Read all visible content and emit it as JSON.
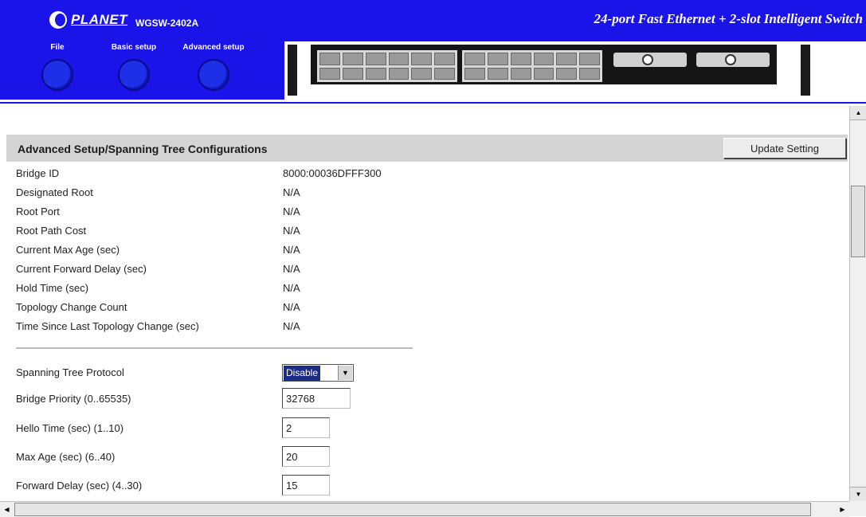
{
  "header": {
    "brand": "PLANET",
    "model": "WGSW-2402A",
    "product_title": "24-port Fast Ethernet + 2-slot Intelligent Switch",
    "menu": [
      {
        "label": "File"
      },
      {
        "label": "Basic setup"
      },
      {
        "label": "Advanced setup"
      }
    ]
  },
  "page": {
    "title": "Advanced Setup/Spanning Tree Configurations",
    "update_button": "Update Setting"
  },
  "status": [
    {
      "label": "Bridge ID",
      "value": "8000:00036DFFF300"
    },
    {
      "label": "Designated Root",
      "value": "N/A"
    },
    {
      "label": "Root Port",
      "value": "N/A"
    },
    {
      "label": "Root Path Cost",
      "value": "N/A"
    },
    {
      "label": "Current Max Age (sec)",
      "value": "N/A"
    },
    {
      "label": "Current Forward Delay (sec)",
      "value": "N/A"
    },
    {
      "label": "Hold Time (sec)",
      "value": "N/A"
    },
    {
      "label": "Topology Change Count",
      "value": "N/A"
    },
    {
      "label": "Time Since Last Topology Change (sec)",
      "value": "N/A"
    }
  ],
  "settings": {
    "stp": {
      "label": "Spanning Tree Protocol",
      "selected": "Disable"
    },
    "bridge_priority": {
      "label": "Bridge Priority (0..65535)",
      "value": "32768"
    },
    "hello_time": {
      "label": "Hello Time (sec) (1..10)",
      "value": "2"
    },
    "max_age": {
      "label": "Max Age (sec) (6..40)",
      "value": "20"
    },
    "forward_delay": {
      "label": "Forward Delay (sec) (4..30)",
      "value": "15"
    }
  },
  "colors": {
    "header_blue": "#1a14e8",
    "title_bar": "#d4d4d4",
    "select_highlight": "#1c2a88"
  },
  "icons": [
    "planet-logo",
    "menu-circle-button",
    "switch-port-panel",
    "scroll-arrow"
  ]
}
